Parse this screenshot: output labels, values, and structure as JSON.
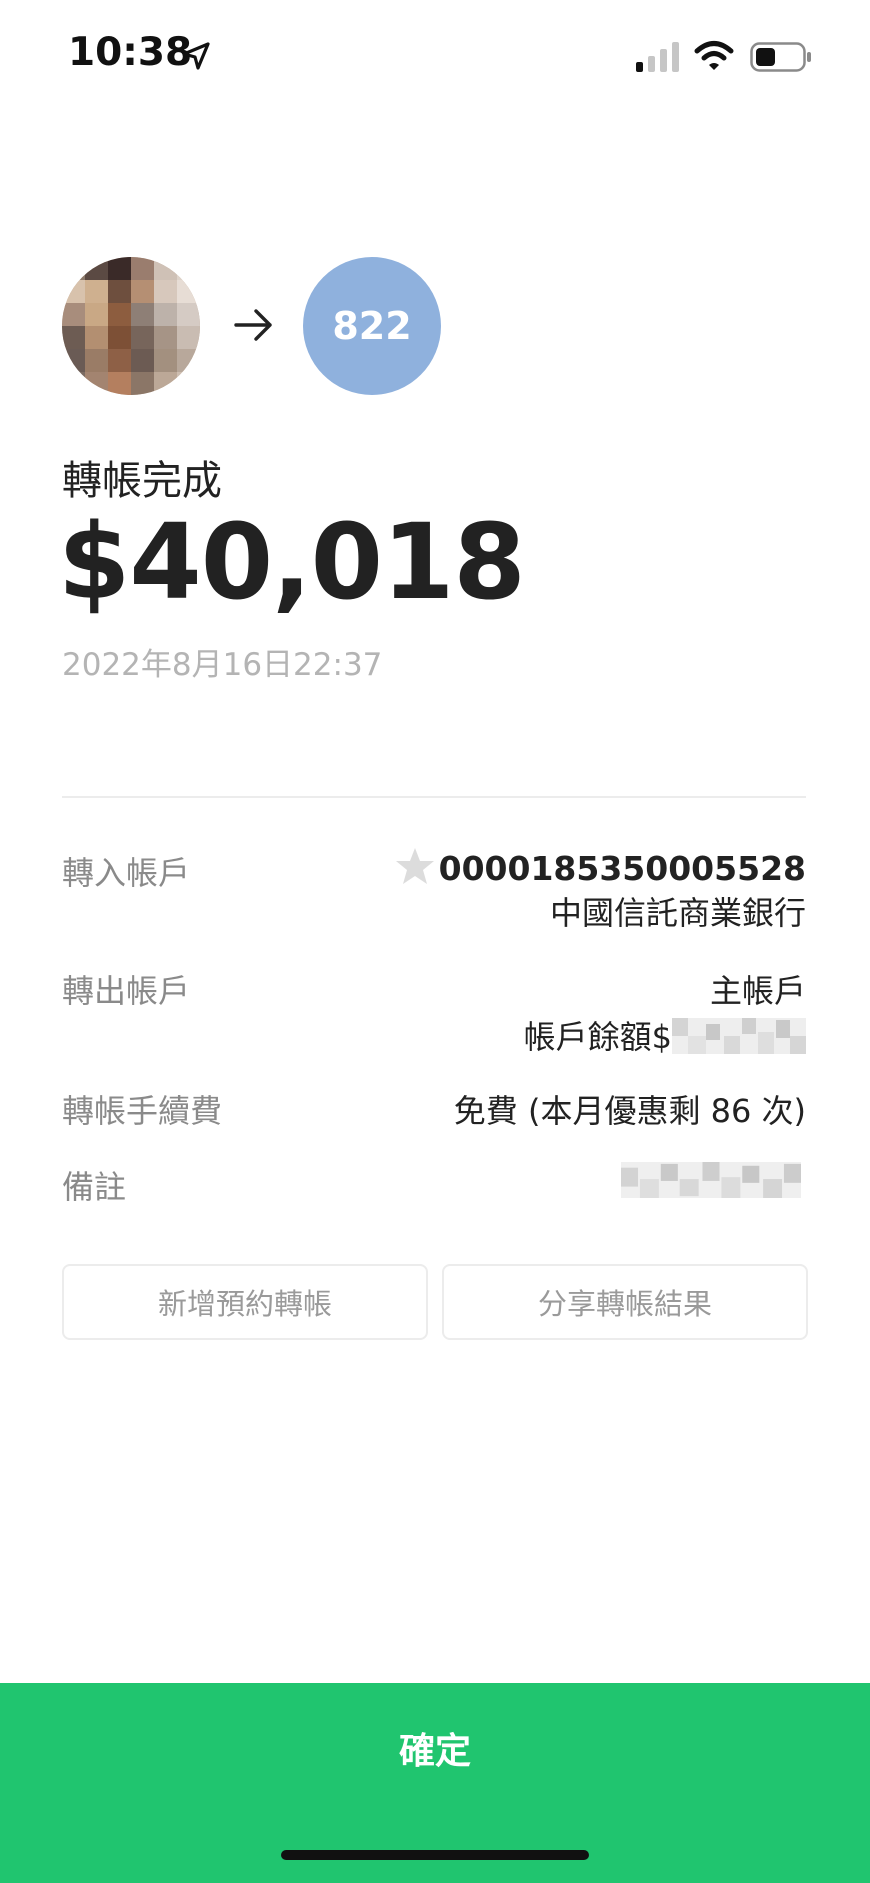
{
  "status_bar": {
    "time": "10:38",
    "icons": [
      "location-arrow-icon",
      "signal-icon",
      "wifi-icon",
      "battery-icon"
    ]
  },
  "transfer": {
    "receiver_bank_code": "822",
    "status_title": "轉帳完成",
    "amount": "$40,018",
    "timestamp": "2022年8月16日22:37"
  },
  "details": {
    "to_account": {
      "label": "轉入帳戶",
      "account_number": "0000185350005528",
      "bank_name": "中國信託商業銀行"
    },
    "from_account": {
      "label": "轉出帳戶",
      "name": "主帳戶",
      "balance_label": "帳戶餘額$"
    },
    "fee": {
      "label": "轉帳手續費",
      "value": "免費 (本月優惠剩 86 次)"
    },
    "memo": {
      "label": "備註"
    }
  },
  "actions": {
    "schedule_label": "新增預約轉帳",
    "share_label": "分享轉帳結果"
  },
  "footer": {
    "confirm_label": "確定"
  },
  "colors": {
    "confirm_green": "#20c56f",
    "bank_avatar_blue": "#8fb1dd",
    "muted_text": "#8a8a8a",
    "timestamp_gray": "#b4b4b4"
  }
}
